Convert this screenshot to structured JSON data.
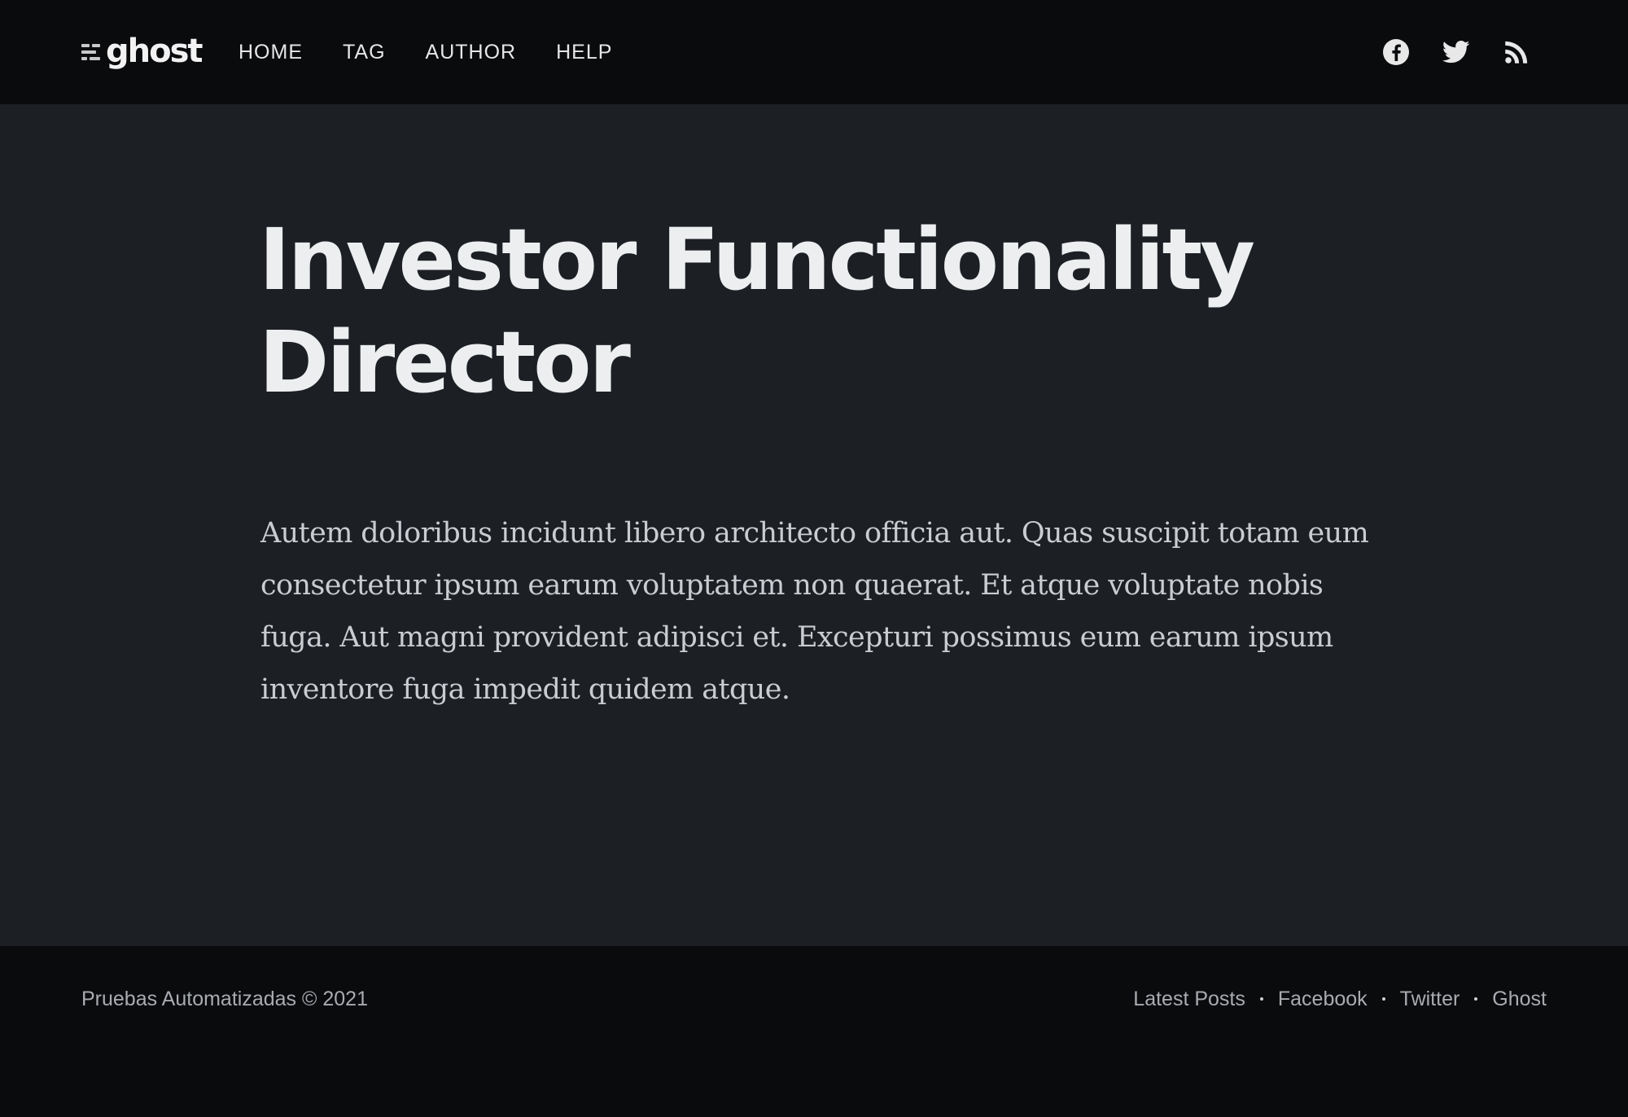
{
  "header": {
    "logo_text": "ghost",
    "nav": [
      {
        "label": "HOME"
      },
      {
        "label": "TAG"
      },
      {
        "label": "AUTHOR"
      },
      {
        "label": "HELP"
      }
    ],
    "social": [
      "facebook-icon",
      "twitter-icon",
      "rss-icon"
    ]
  },
  "post": {
    "title": "Investor Functionality Director",
    "body": "Autem doloribus incidunt libero architecto officia aut. Quas suscipit totam eum consectetur ipsum earum voluptatem non quaerat. Et atque voluptate nobis fuga. Aut magni provident adipisci et. Excepturi possimus eum earum ipsum inventore fuga impedit quidem atque."
  },
  "footer": {
    "copyright": "Pruebas Automatizadas © 2021",
    "links": [
      {
        "label": "Latest Posts"
      },
      {
        "label": "Facebook"
      },
      {
        "label": "Twitter"
      },
      {
        "label": "Ghost"
      }
    ]
  },
  "colors": {
    "header_bg": "#0a0b0d",
    "main_bg": "#1c1f24",
    "title": "#eceef0",
    "body_text": "#c9ccd0",
    "footer_text": "#a8abb0"
  }
}
